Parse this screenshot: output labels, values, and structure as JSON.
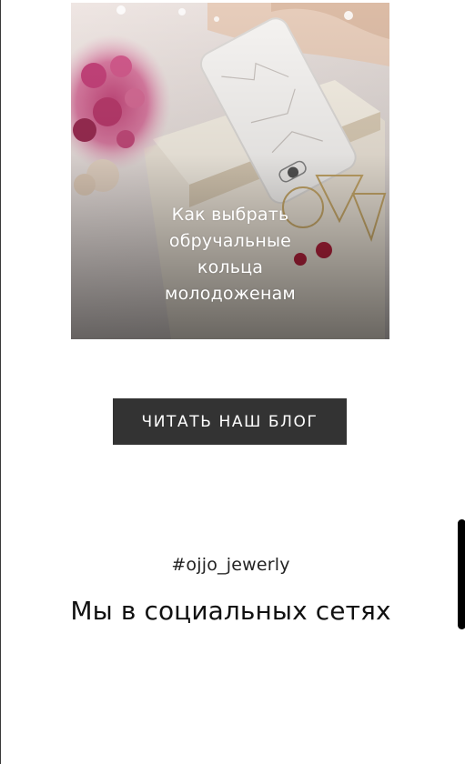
{
  "blog_card": {
    "title_lines": [
      "Как выбрать",
      "обручальные",
      "кольца",
      "молодоженам"
    ]
  },
  "blog_button": {
    "label": "ЧИТАТЬ НАШ БЛОГ"
  },
  "social": {
    "hashtag": "#ojjo_jewerly",
    "title": "Мы в социальных сетях"
  },
  "colors": {
    "button_bg": "#333333",
    "text_dark": "#111111"
  }
}
